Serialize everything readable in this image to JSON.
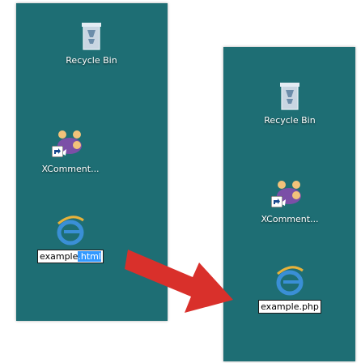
{
  "left_panel": {
    "recycle_label": "Recycle Bin",
    "xcomment_label": "XComment...",
    "rename": {
      "name": "example",
      "ext": ".html"
    }
  },
  "right_panel": {
    "recycle_label": "Recycle Bin",
    "xcomment_label": "XComment...",
    "filename": "example.php"
  },
  "colors": {
    "desktop": "#1e6e74",
    "arrow": "#d9302b",
    "selection": "#3399ff"
  },
  "icons": [
    "recycle-bin-icon",
    "xcomment-app-icon",
    "shortcut-arrow-icon",
    "ie-file-icon"
  ]
}
